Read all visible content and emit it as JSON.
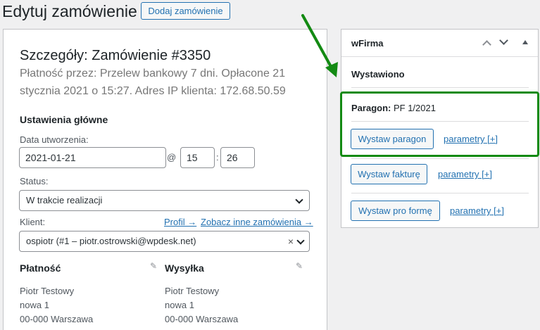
{
  "header": {
    "title": "Edytuj zamówienie",
    "add_button": "Dodaj zamówienie"
  },
  "order": {
    "heading": "Szczegóły: Zamówienie #3350",
    "meta": "Płatność przez: Przelew bankowy 7 dni. Opłacone 21 stycznia 2021 o 15:27. Adres IP klienta: 172.68.50.59",
    "section_title": "Ustawienia główne",
    "date_label": "Data utworzenia:",
    "date_value": "2021-01-21",
    "at_sign": "@",
    "hour": "15",
    "colon": ":",
    "minute": "26",
    "status_label": "Status:",
    "status_value": "W trakcie realizacji",
    "client_label": "Klient:",
    "profile_link": "Profil →",
    "other_orders_link": "Zobacz inne zamówienia →",
    "client_value": "ospiotr (#1 – piotr.ostrowski@wpdesk.net)",
    "clear": "×",
    "billing": {
      "title": "Płatność",
      "lines": [
        "Piotr Testowy",
        "nowa 1",
        "00-000 Warszawa"
      ]
    },
    "shipping": {
      "title": "Wysyłka",
      "lines": [
        "Piotr Testowy",
        "nowa 1",
        "00-000 Warszawa"
      ]
    }
  },
  "wfirma": {
    "title": "wFirma",
    "status": "Wystawiono",
    "paragon_label": "Paragon:",
    "paragon_value": "PF 1/2021",
    "buttons": [
      {
        "label": "Wystaw paragon",
        "link": "parametry [+]"
      },
      {
        "label": "Wystaw fakturę",
        "link": "parametry [+]"
      },
      {
        "label": "Wystaw pro formę",
        "link": "parametry [+]"
      }
    ]
  },
  "colors": {
    "accent": "#2271b1",
    "highlight": "#138a13"
  }
}
